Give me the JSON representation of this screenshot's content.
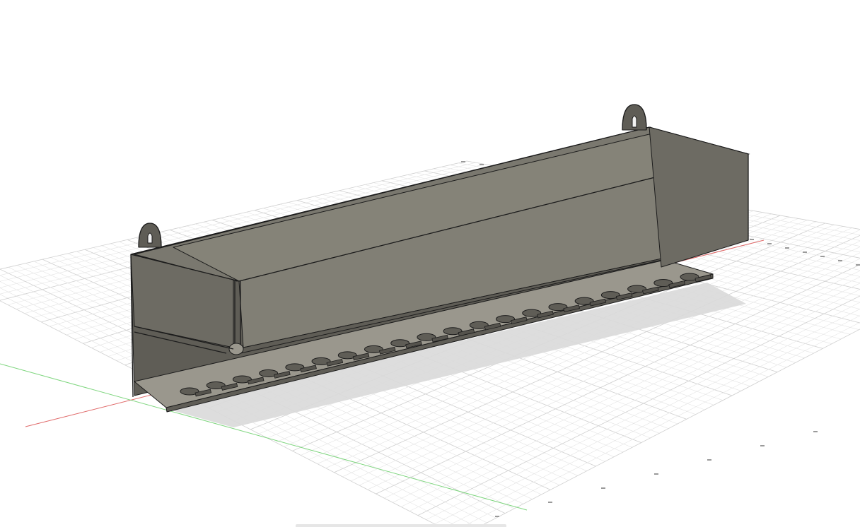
{
  "viewport": {
    "background": "#ffffff",
    "colors": {
      "grid_minor": "#e4e4e4",
      "grid_major": "#cfcfcf",
      "x_axis": "#e06a6a",
      "y_axis": "#7fd67f",
      "model_body": "#7a786f",
      "model_dark": "#5f5d56",
      "model_light": "#9a978d",
      "model_edge": "#1c1c1c",
      "shadow": "#d9d9d9"
    }
  },
  "model": {
    "shape": "wall-mounted-tool-tray",
    "slot_count": 20,
    "hanger_tab_count": 2
  }
}
